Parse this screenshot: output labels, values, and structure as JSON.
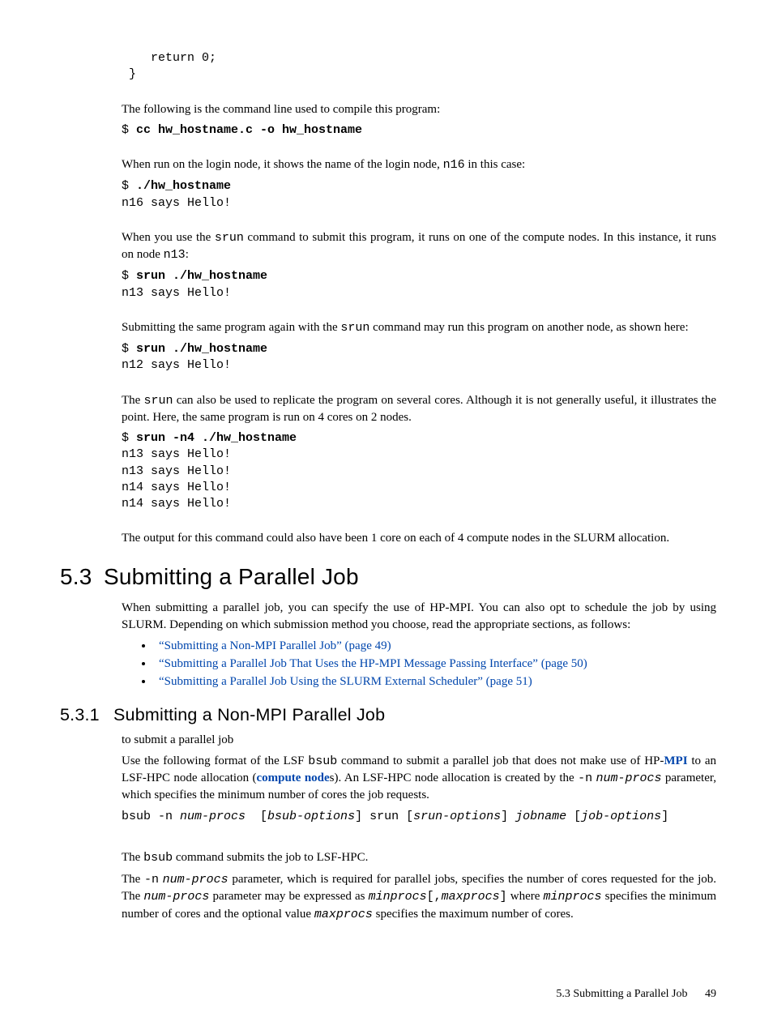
{
  "code0": "    return 0;\n }",
  "p1_a": "The following is the command line used to compile this program:",
  "code1_prompt": "$ ",
  "code1_cmd": "cc hw_hostname.c -o hw_hostname",
  "p2_a": "When run on the login node, it shows the name of the login node, ",
  "p2_code": "n16",
  "p2_b": " in this case:",
  "code2_prompt": "$ ",
  "code2_cmd": "./hw_hostname",
  "code2_out": "n16 says Hello!",
  "p3_a": "When you use the ",
  "p3_code": "srun",
  "p3_b": " command to submit this program, it runs on one of the compute nodes. In this instance, it runs on node ",
  "p3_code2": "n13",
  "p3_c": ":",
  "code3_prompt": "$ ",
  "code3_cmd": "srun ./hw_hostname",
  "code3_out": "n13 says Hello!",
  "p4_a": "Submitting the same program again with the ",
  "p4_code": "srun",
  "p4_b": " command may run this program on another node, as shown here:",
  "code4_prompt": "$ ",
  "code4_cmd": "srun ./hw_hostname",
  "code4_out": "n12 says Hello!",
  "p5_a": "The ",
  "p5_code": "srun",
  "p5_b": " can also be used to replicate the program on several cores. Although it is not generally useful, it illustrates the point. Here, the same program is run on 4 cores on 2 nodes.",
  "code5_prompt": "$ ",
  "code5_cmd": "srun -n4 ./hw_hostname",
  "code5_out": "n13 says Hello!\nn13 says Hello!\nn14 says Hello!\nn14 says Hello!",
  "p6": "The output for this command could also have been 1 core on each of 4 compute nodes in the SLURM allocation.",
  "sec_num": "5.3",
  "sec_title": "Submitting a Parallel Job",
  "p7": "When submitting a parallel job, you can specify the use of HP-MPI. You can also opt to schedule the job by using SLURM. Depending on which submission method you choose, read the appropriate sections, as follows:",
  "li1": "“Submitting a Non-MPI Parallel Job” (page 49)",
  "li2": "“Submitting a Parallel Job That Uses the HP-MPI Message Passing Interface” (page 50)",
  "li3": "“Submitting a Parallel Job Using the SLURM External Scheduler” (page 51)",
  "subsec_num": "5.3.1",
  "subsec_title": "Submitting a Non-MPI Parallel Job",
  "p8": "to submit a parallel job",
  "p9_a": "Use the following format of the LSF ",
  "p9_code1": "bsub",
  "p9_b": " command to submit a parallel job that does not make use of HP-",
  "p9_link1": "MPI",
  "p9_c": " to an LSF-HPC node allocation (",
  "p9_link2": "compute node",
  "p9_d": "s). An LSF-HPC node allocation is created by the ",
  "p9_code2": "-n",
  "p9_sp": " ",
  "p9_ital1": "num-procs",
  "p9_e": " parameter, which specifies the minimum number of cores the job requests.",
  "synopsis_a": "bsub -n ",
  "synopsis_b": "num-procs",
  "synopsis_c": "  [",
  "synopsis_d": "bsub-options",
  "synopsis_e": "] srun [",
  "synopsis_f": "srun-options",
  "synopsis_g": "] ",
  "synopsis_h": "jobname",
  "synopsis_i": " [",
  "synopsis_j": "job-options",
  "synopsis_k": "]",
  "p10_a": "The ",
  "p10_code": "bsub",
  "p10_b": " command submits the job to LSF-HPC.",
  "p11_a": "The ",
  "p11_code1": "-n",
  "p11_sp": " ",
  "p11_ital1": "num-procs",
  "p11_b": " parameter, which is required for parallel jobs, specifies the number of cores requested for the job. The ",
  "p11_ital2": "num-procs",
  "p11_c": " parameter may be expressed as ",
  "p11_ital3": "minprocs",
  "p11_code2": "[,",
  "p11_ital4": "maxprocs",
  "p11_code3": "]",
  "p11_d": " where ",
  "p11_ital5": "minprocs",
  "p11_e": " specifies the minimum number of cores and the optional value ",
  "p11_ital6": "maxprocs",
  "p11_f": " specifies the maximum number of cores.",
  "footer_text": "5.3 Submitting a Parallel Job",
  "footer_page": "49"
}
